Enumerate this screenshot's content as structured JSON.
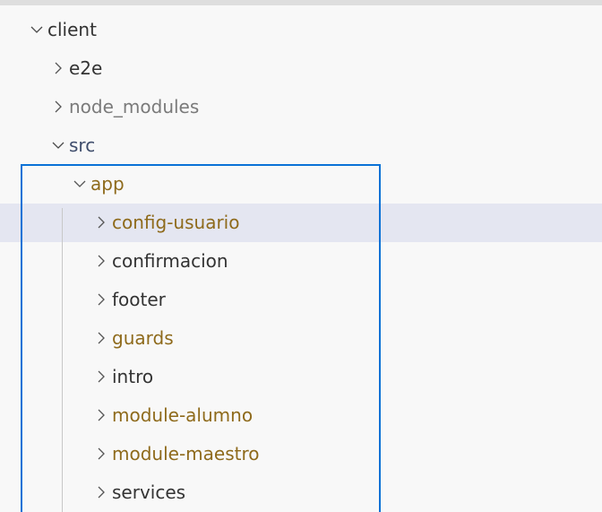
{
  "explorer": {
    "colors": {
      "background": "#f8f8f8",
      "hover_row": "#e4e6f1",
      "focus_border": "#0a72d6",
      "text_default": "#333333",
      "text_dimmed": "#7a7a7a",
      "text_modified": "#8e6a1b",
      "text_src": "#3f4d6c"
    },
    "items": [
      {
        "label": "client",
        "expanded": true,
        "depth": 0,
        "state": "default",
        "icon": "chevron-down-icon"
      },
      {
        "label": "e2e",
        "expanded": false,
        "depth": 1,
        "state": "default",
        "icon": "chevron-right-icon"
      },
      {
        "label": "node_modules",
        "expanded": false,
        "depth": 1,
        "state": "dimmed",
        "icon": "chevron-right-icon"
      },
      {
        "label": "src",
        "expanded": true,
        "depth": 1,
        "state": "src",
        "icon": "chevron-down-icon"
      },
      {
        "label": "app",
        "expanded": true,
        "depth": 2,
        "state": "modified",
        "icon": "chevron-down-icon"
      },
      {
        "label": "config-usuario",
        "expanded": false,
        "depth": 3,
        "state": "modified",
        "icon": "chevron-right-icon",
        "hovered": true
      },
      {
        "label": "confirmacion",
        "expanded": false,
        "depth": 3,
        "state": "default",
        "icon": "chevron-right-icon"
      },
      {
        "label": "footer",
        "expanded": false,
        "depth": 3,
        "state": "default",
        "icon": "chevron-right-icon"
      },
      {
        "label": "guards",
        "expanded": false,
        "depth": 3,
        "state": "modified",
        "icon": "chevron-right-icon"
      },
      {
        "label": "intro",
        "expanded": false,
        "depth": 3,
        "state": "default",
        "icon": "chevron-right-icon"
      },
      {
        "label": "module-alumno",
        "expanded": false,
        "depth": 3,
        "state": "modified",
        "icon": "chevron-right-icon"
      },
      {
        "label": "module-maestro",
        "expanded": false,
        "depth": 3,
        "state": "modified",
        "icon": "chevron-right-icon"
      },
      {
        "label": "services",
        "expanded": false,
        "depth": 3,
        "state": "default",
        "icon": "chevron-right-icon"
      }
    ]
  }
}
